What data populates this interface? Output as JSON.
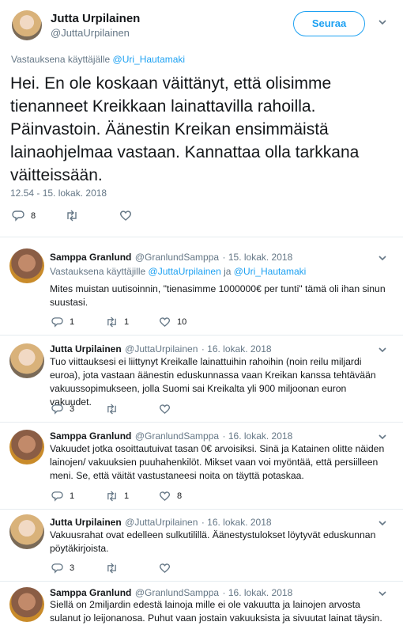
{
  "main_tweet": {
    "author_name": "Jutta Urpilainen",
    "author_handle": "@JuttaUrpilainen",
    "follow_label": "Seuraa",
    "reply_prefix": "Vastauksena käyttäjälle",
    "reply_to": "@Uri_Hautamaki",
    "text": "Hei. En ole koskaan väittänyt, että olisimme tienanneet Kreikkaan lainattavilla rahoilla. Päinvastoin. Äänestin Kreikan ensimmäistä lainaohjelmaa vastaan. Kannattaa olla tarkkana väitteissään.",
    "timestamp": "12.54 - 15. lokak. 2018",
    "reply_count": "8"
  },
  "replies": [
    {
      "author_name": "Samppa Granlund",
      "author_handle": "@GranlundSamppa",
      "date": "· 15. lokak. 2018",
      "reply_prefix": "Vastauksena käyttäjille",
      "reply_to_1": "@JuttaUrpilainen",
      "reply_join": "ja",
      "reply_to_2": "@Uri_Hautamaki",
      "text": "Mites muistan uutisoinnin, \"tienasimme 1000000€ per tunti\" tämä oli ihan sinun suustasi.",
      "reply_count": "1",
      "retweet_count": "1",
      "like_count": "10"
    },
    {
      "author_name": "Jutta Urpilainen",
      "author_handle": "@JuttaUrpilainen",
      "date": "· 16. lokak. 2018",
      "text": "Tuo viittauksesi ei liittynyt Kreikalle lainattuihin rahoihin (noin reilu miljardi euroa), jota vastaan äänestin eduskunnassa vaan Kreikan kanssa tehtävään vakuussopimukseen, jolla Suomi sai Kreikalta yli 900 miljoonan euron vakuudet.",
      "reply_count": "3"
    },
    {
      "author_name": "Samppa Granlund",
      "author_handle": "@GranlundSamppa",
      "date": "· 16. lokak. 2018",
      "text": "Vakuudet jotka osoittautuivat tasan 0€ arvoisiksi. Sinä ja Katainen olitte näiden lainojen/ vakuuksien puuhahenkilöt. Mikset vaan voi myöntää, että persiilleen meni. Se, että väität vastustaneesi noita on täyttä potaskaa.",
      "reply_count": "1",
      "retweet_count": "1",
      "like_count": "8"
    },
    {
      "author_name": "Jutta Urpilainen",
      "author_handle": "@JuttaUrpilainen",
      "date": "· 16. lokak. 2018",
      "text": "Vakuusrahat ovat edelleen sulkutilillä. Äänestystulokset löytyvät eduskunnan pöytäkirjoista.",
      "reply_count": "3"
    },
    {
      "author_name": "Samppa Granlund",
      "author_handle": "@GranlundSamppa",
      "date": "· 16. lokak. 2018",
      "text": "Siellä on 2miljardin edestä lainoja mille ei ole vakuutta ja lainojen arvosta sulanut jo leijonanosa. Puhut vaan jostain vakuuksista ja sivuutat lainat täysin."
    }
  ],
  "icons": {
    "reply": "reply-icon",
    "retweet": "retweet-icon",
    "like": "heart-icon",
    "more": "chevron-down-icon"
  },
  "colors": {
    "accent": "#1da1f2",
    "secondary_text": "#657786",
    "divider": "#e6ecf0"
  }
}
